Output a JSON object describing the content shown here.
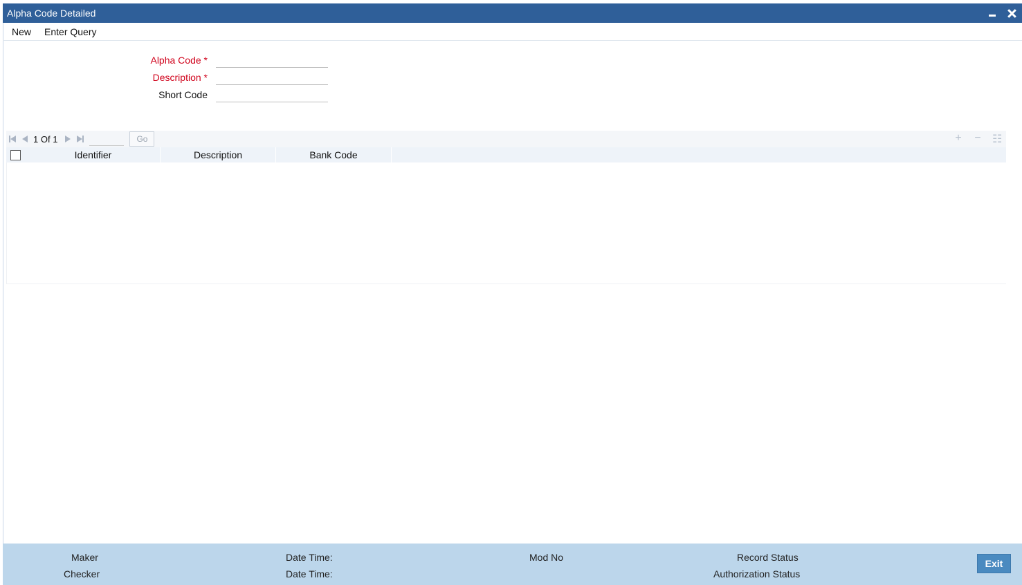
{
  "window": {
    "title": "Alpha Code Detailed"
  },
  "menu": {
    "new_label": "New",
    "enter_query_label": "Enter Query"
  },
  "form": {
    "alpha_code_label": "Alpha Code *",
    "alpha_code_value": "",
    "description_label": "Description *",
    "description_value": "",
    "short_code_label": "Short Code",
    "short_code_value": ""
  },
  "grid": {
    "page_current": "1",
    "page_of_label": "Of",
    "page_total": "1",
    "go_label": "Go",
    "columns": [
      "Identifier",
      "Description",
      "Bank Code"
    ],
    "rows": []
  },
  "footer": {
    "maker_label": "Maker",
    "checker_label": "Checker",
    "date_time_label_1": "Date Time:",
    "date_time_label_2": "Date Time:",
    "mod_no_label": "Mod No",
    "record_status_label": "Record Status",
    "authorization_status_label": "Authorization Status",
    "exit_label": "Exit"
  },
  "colors": {
    "title_bar": "#2f5f99",
    "required_label": "#d0021b",
    "footer_bg": "#bcd6eb",
    "exit_button": "#4a8ac0"
  }
}
